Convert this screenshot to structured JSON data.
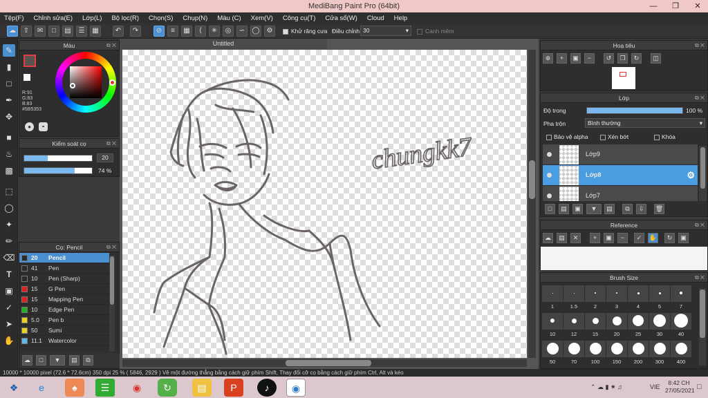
{
  "app": {
    "title": "MediBang Paint Pro (64bit)"
  },
  "menu": [
    "Tệp(F)",
    "Chỉnh sửa(E)",
    "Lớp(L)",
    "Bộ lọc(R)",
    "Chọn(S)",
    "Chụp(N)",
    "Màu (C)",
    "Xem(V)",
    "Công cụ(T)",
    "Cửa sổ(W)",
    "Cloud",
    "Help"
  ],
  "toolbar": {
    "antialias_label": "Khử răng cưa",
    "adjust_label": "Điều chỉnh",
    "adjust_value": "30",
    "edge_label": "Canh mềm"
  },
  "color_panel": {
    "title": "Màu",
    "r": "R:91",
    "g": "G:83",
    "b": "B:83",
    "hex": "#5B5353",
    "fg_color": "#5b5353"
  },
  "brush_control": {
    "title": "Kiểm soát cọ",
    "size": "20",
    "size_fraction": 0.35,
    "opacity": "74 %",
    "opacity_fraction": 0.74
  },
  "brush_panel": {
    "title": "Cọ: Pencil",
    "items": [
      {
        "size": "20",
        "name": "Pencil",
        "color": "#2a2a2a",
        "selected": true
      },
      {
        "size": "41",
        "name": "Pen",
        "color": "#2a2a2a"
      },
      {
        "size": "10",
        "name": "Pen (Sharp)",
        "color": "#2a2a2a"
      },
      {
        "size": "15",
        "name": "G Pen",
        "color": "#e02020"
      },
      {
        "size": "15",
        "name": "Mapping Pen",
        "color": "#e02020"
      },
      {
        "size": "10",
        "name": "Edge Pen",
        "color": "#20b020"
      },
      {
        "size": "5.0",
        "name": "Pen b",
        "color": "#e8d020"
      },
      {
        "size": "50",
        "name": "Sumi",
        "color": "#e8d020"
      },
      {
        "size": "11.1",
        "name": "Watercolor",
        "color": "#60b8e8"
      }
    ]
  },
  "document": {
    "tab": "Untitled",
    "signature": "chungkk7"
  },
  "navigator": {
    "title": "Hoạ tiêu"
  },
  "layers": {
    "title": "Lớp",
    "opacity_label": "Độ trong",
    "opacity_value": "100 %",
    "blend_label": "Pha trộn",
    "blend_value": "Bình thường",
    "protect_alpha": "Bảo vệ alpha",
    "clipping": "Xén bớt",
    "lock": "Khóa",
    "items": [
      {
        "name": "Lớp9",
        "selected": false
      },
      {
        "name": "Lớp8",
        "selected": true
      },
      {
        "name": "Lớp7",
        "selected": false
      }
    ]
  },
  "reference": {
    "title": "Reference"
  },
  "brush_size": {
    "title": "Brush Size",
    "sizes": [
      "1",
      "1.5",
      "2",
      "3",
      "4",
      "5",
      "7",
      "10",
      "12",
      "15",
      "20",
      "25",
      "30",
      "40",
      "50",
      "70",
      "100",
      "150",
      "200",
      "300",
      "400"
    ]
  },
  "status": {
    "text": "10000 * 10000 pixel   (72.6 * 72.6cm)   350 dpi   25 %   ( 5846, 2929 )   Vẽ một đường thẳng bằng cách giữ phím Shift, Thay đổi cỡ cọ bằng cách giữ phím Ctrl, Alt và kéo"
  },
  "taskbar": {
    "lang": "VIE",
    "time": "8:42 CH",
    "date": "27/05/2021"
  }
}
